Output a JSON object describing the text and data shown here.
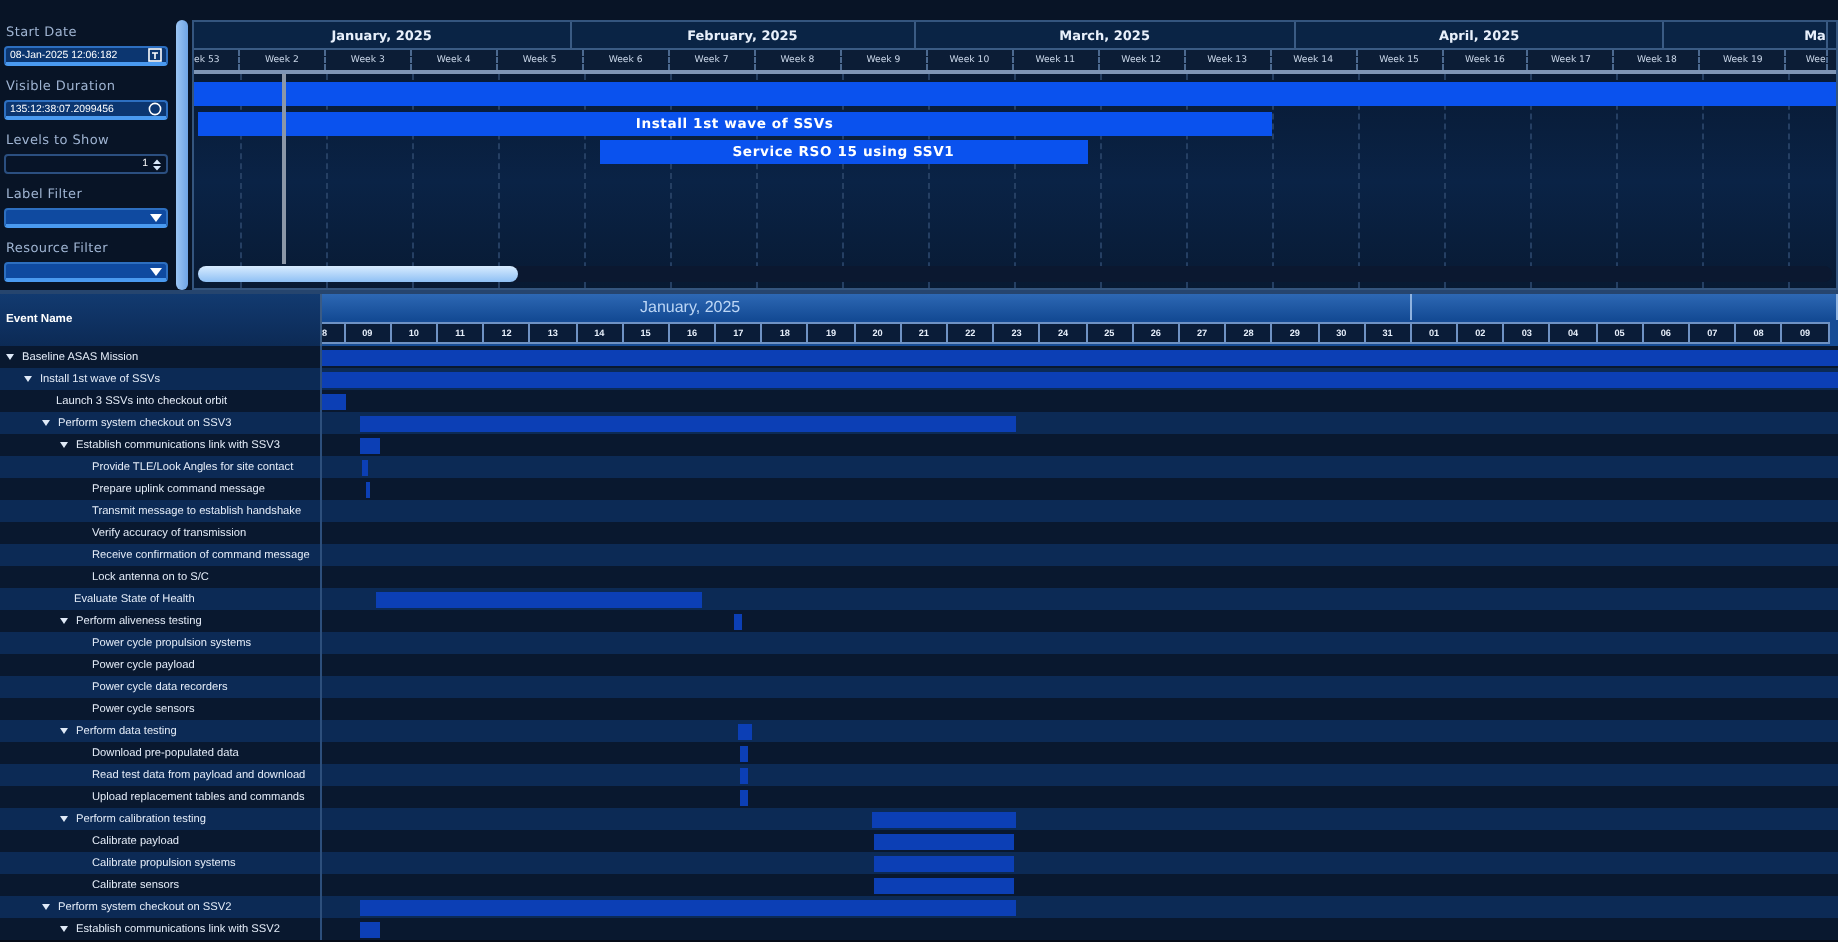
{
  "controls": [
    {
      "kind": "date",
      "label": "Start Date",
      "value": "08-Jan-2025 12:06:182"
    },
    {
      "kind": "duration",
      "label": "Visible Duration",
      "value": "135:12:38:07.2099456"
    },
    {
      "kind": "spinner",
      "label": "Levels to Show",
      "value": "1"
    },
    {
      "kind": "dropdown",
      "label": "Label Filter"
    },
    {
      "kind": "dropdown",
      "label": "Resource Filter"
    }
  ],
  "overview": {
    "months": [
      "January, 2025",
      "February, 2025",
      "March, 2025",
      "April, 2025",
      "Ma"
    ],
    "weeks": [
      "ek 53",
      "Week 2",
      "Week 3",
      "Week 4",
      "Week 5",
      "Week 6",
      "Week 7",
      "Week 8",
      "Week 9",
      "Week 10",
      "Week 11",
      "Week 12",
      "Week 13",
      "Week 14",
      "Week 15",
      "Week 16",
      "Week 17",
      "Week 18",
      "Week 19",
      "Wee"
    ],
    "bars": [
      {
        "kind": "bar"
      },
      {
        "kind": "bar",
        "label": "Install 1st wave of SSVs"
      },
      {
        "kind": "bar",
        "label": "Service RSO 15 using SSV1"
      }
    ]
  },
  "gantt": {
    "column_title": "Event Name",
    "month": "January, 2025",
    "days": [
      "8",
      "09",
      "10",
      "11",
      "12",
      "13",
      "14",
      "15",
      "16",
      "17",
      "18",
      "19",
      "20",
      "21",
      "22",
      "23",
      "24",
      "25",
      "26",
      "27",
      "28",
      "29",
      "30",
      "31",
      "01",
      "02",
      "03",
      "04",
      "05",
      "06",
      "07",
      "08",
      "09"
    ],
    "tasks": [
      {
        "name": "Baseline ASAS Mission",
        "expanded": true,
        "children": [
          {
            "name": "Install 1st wave of SSVs",
            "expanded": true,
            "children": [
              {
                "name": "Launch 3 SSVs into checkout orbit"
              },
              {
                "name": "Perform system checkout on SSV3",
                "expanded": true,
                "children": [
                  {
                    "name": "Establish communications link with SSV3",
                    "expanded": true,
                    "children": [
                      {
                        "name": "Provide TLE/Look Angles for site contact"
                      },
                      {
                        "name": "Prepare uplink command message"
                      },
                      {
                        "name": "Transmit message to establish handshake"
                      },
                      {
                        "name": "Verify accuracy of transmission"
                      },
                      {
                        "name": "Receive confirmation of command message"
                      },
                      {
                        "name": "Lock antenna on to S/C"
                      }
                    ]
                  },
                  {
                    "name": "Evaluate State of Health"
                  },
                  {
                    "name": "Perform aliveness testing",
                    "expanded": true,
                    "children": [
                      {
                        "name": "Power cycle propulsion systems"
                      },
                      {
                        "name": "Power cycle payload"
                      },
                      {
                        "name": "Power cycle data recorders"
                      },
                      {
                        "name": "Power cycle sensors"
                      }
                    ]
                  },
                  {
                    "name": "Perform data testing",
                    "expanded": true,
                    "children": [
                      {
                        "name": "Download pre-populated data"
                      },
                      {
                        "name": "Read test data from payload and download"
                      },
                      {
                        "name": "Upload replacement tables and commands"
                      }
                    ]
                  },
                  {
                    "name": "Perform calibration testing",
                    "expanded": true,
                    "children": [
                      {
                        "name": "Calibrate payload"
                      },
                      {
                        "name": "Calibrate propulsion systems"
                      },
                      {
                        "name": "Calibrate sensors"
                      }
                    ]
                  }
                ]
              },
              {
                "name": "Perform system checkout on SSV2",
                "expanded": true,
                "children": [
                  {
                    "name": "Establish communications link with SSV2",
                    "expanded": true
                  }
                ]
              }
            ]
          }
        ]
      }
    ]
  }
}
